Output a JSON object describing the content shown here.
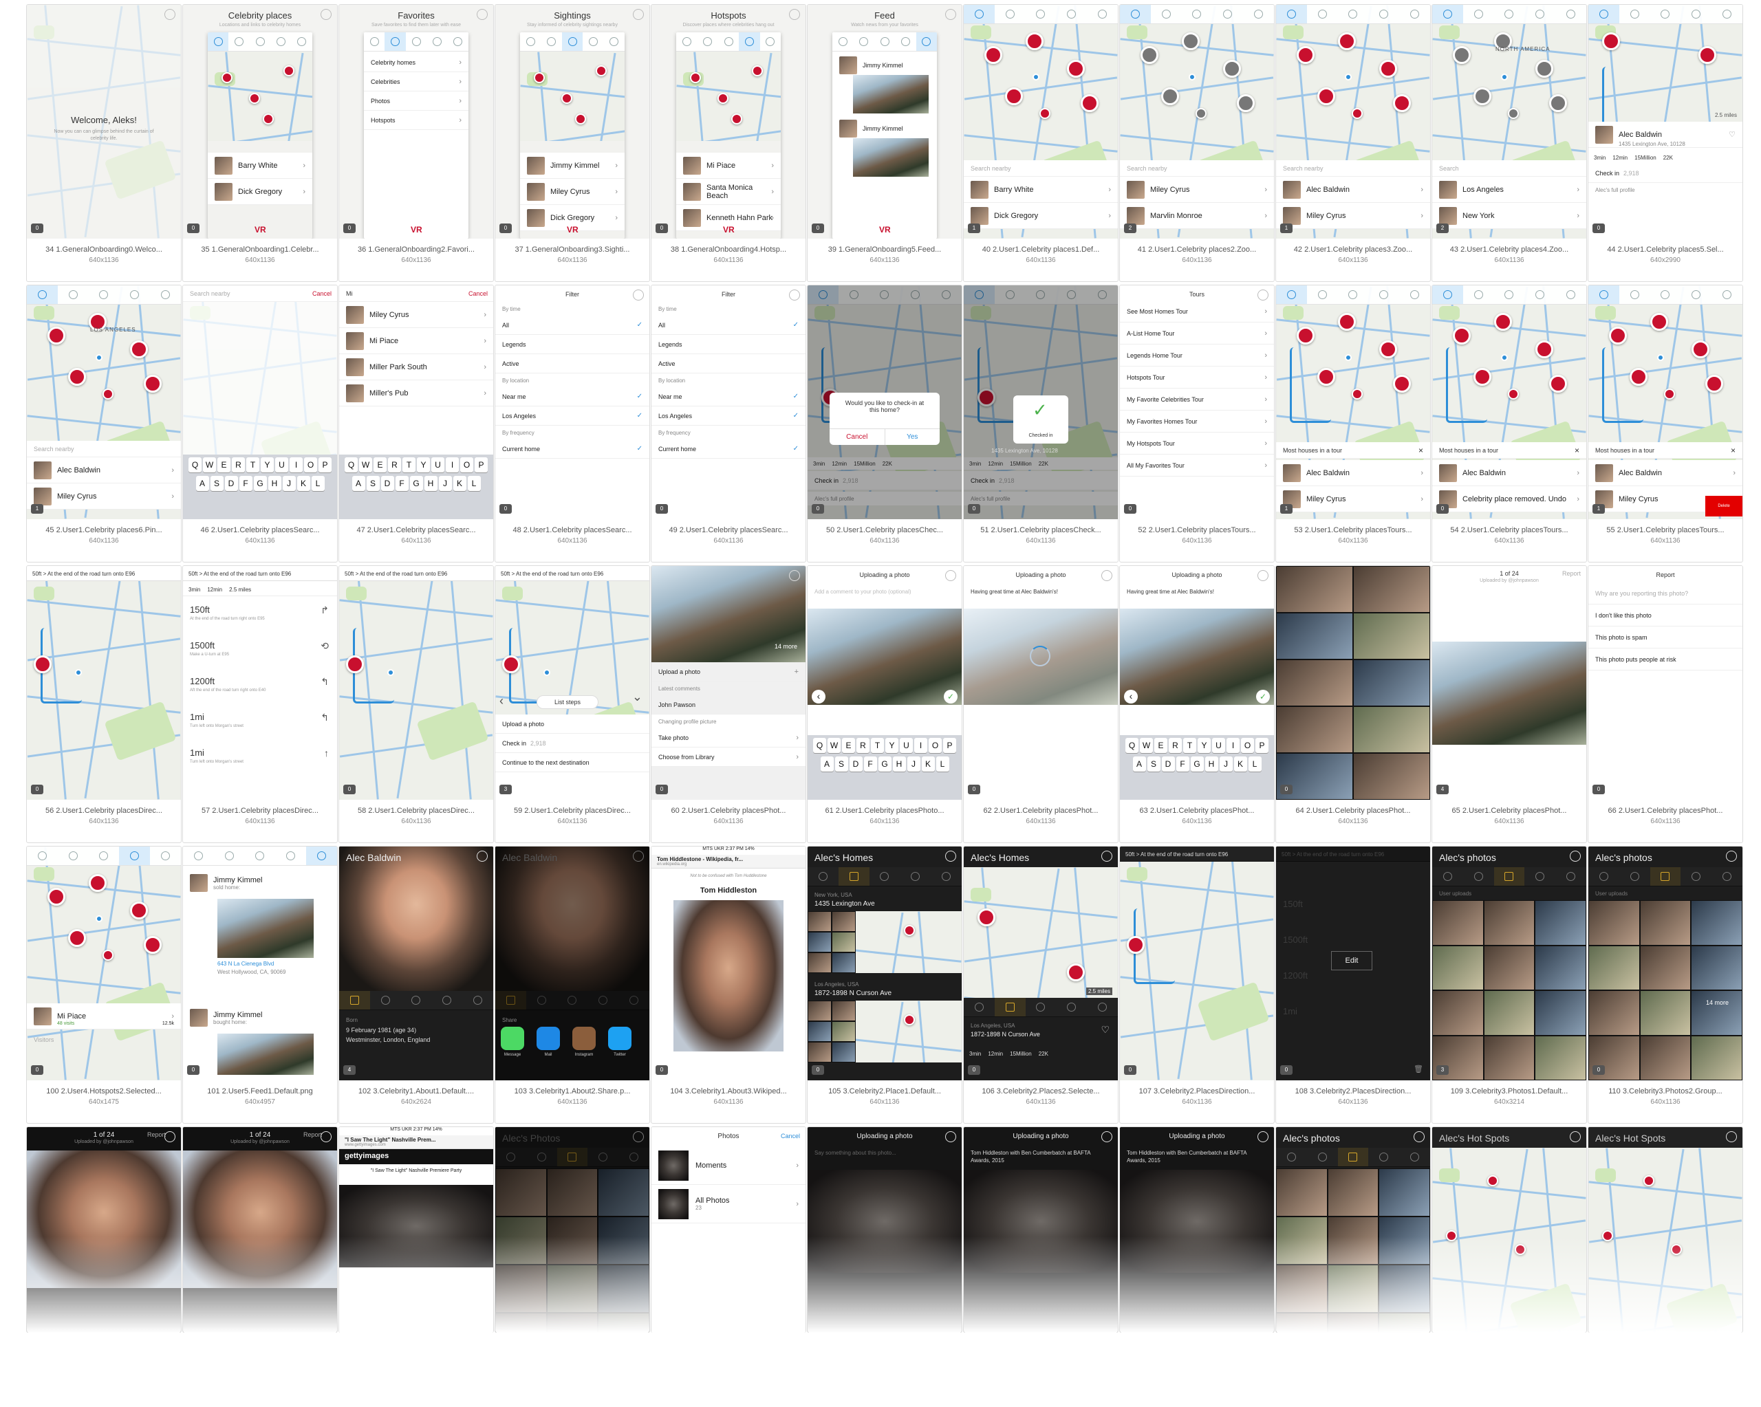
{
  "rows": [
    [
      {
        "caption": "34 1.GeneralOnboarding0.Welco...",
        "dims": "640x1136",
        "kind": "welcome",
        "title": "Welcome, Aleks!",
        "sub": "Now you can can glimpse behind the curtain of celebrity life.",
        "badge": "0"
      },
      {
        "caption": "35 1.GeneralOnboarding1.Celebr...",
        "dims": "640x1136",
        "kind": "onboard-map",
        "title": "Celebrity places",
        "sub": "Locations and links to celebrity homes",
        "list": [
          "Barry White",
          "Dick Gregory"
        ],
        "badge": "0"
      },
      {
        "caption": "36 1.GeneralOnboarding2.Favori...",
        "dims": "640x1136",
        "kind": "onboard-list",
        "title": "Favorites",
        "sub": "Save favorites to find them later with ease",
        "list": [
          "Celebrity homes",
          "Celebrities",
          "Photos",
          "Hotspots"
        ],
        "badge": "0"
      },
      {
        "caption": "37 1.GeneralOnboarding3.Sighti...",
        "dims": "640x1136",
        "kind": "onboard-map",
        "title": "Sightings",
        "sub": "Stay informed of celebrity sightings nearby",
        "list": [
          "Jimmy Kimmel",
          "Miley Cyrus",
          "Dick Gregory"
        ],
        "badge": "0"
      },
      {
        "caption": "38 1.GeneralOnboarding4.Hotsp...",
        "dims": "640x1136",
        "kind": "onboard-map",
        "title": "Hotspots",
        "sub": "Discover places where celebrities hang out",
        "list": [
          "Mi Piace",
          "Santa Monica Beach",
          "Kenneth Hahn Park"
        ],
        "badge": "0"
      },
      {
        "caption": "39 1.GeneralOnboarding5.Feed...",
        "dims": "640x1136",
        "kind": "onboard-feed",
        "title": "Feed",
        "sub": "Watch news from your favorites",
        "list": [
          "Jimmy Kimmel",
          "Jimmy Kimmel"
        ],
        "badge": "0"
      },
      {
        "caption": "40 2.User1.Celebrity places1.Def...",
        "dims": "640x1136",
        "kind": "map-list",
        "search": "Search nearby",
        "list": [
          "Barry White",
          "Dick Gregory"
        ],
        "badge": "1"
      },
      {
        "caption": "41 2.User1.Celebrity places2.Zoo...",
        "dims": "640x1136",
        "kind": "map-list",
        "search": "Search nearby",
        "list": [
          "Miley Cyrus",
          "Marvlin Monroe"
        ],
        "badge": "2"
      },
      {
        "caption": "42 2.User1.Celebrity places3.Zoo...",
        "dims": "640x1136",
        "kind": "map-list",
        "search": "Search nearby",
        "list": [
          "Alec Baldwin",
          "Miley Cyrus"
        ],
        "badge": "1"
      },
      {
        "caption": "43 2.User1.Celebrity places4.Zoo...",
        "dims": "640x1136",
        "kind": "map-list",
        "search": "Search",
        "list": [
          "Los Angeles",
          "New York"
        ],
        "badge": "2",
        "label": "NORTH AMERICA"
      },
      {
        "caption": "44 2.User1.Celebrity places5.Sel...",
        "dims": "640x2990",
        "kind": "map-detail",
        "list": [
          "Alec Baldwin"
        ],
        "detail": "1435 Lexington Ave, 10128",
        "stats": [
          "3min",
          "12min",
          "15Million",
          "22K"
        ],
        "checkin": "Check in",
        "checkin_count": "2,918",
        "extra": "Alec's full profile",
        "badge": "0"
      }
    ],
    [
      {
        "caption": "45 2.User1.Celebrity places6.Pin...",
        "dims": "640x1136",
        "kind": "map-list",
        "search": "Search nearby",
        "list": [
          "Alec Baldwin",
          "Miley Cyrus"
        ],
        "badge": "1",
        "label": "LOS ANGELES",
        "scale": "2.5 miles"
      },
      {
        "caption": "46 2.User1.Celebrity placesSearc...",
        "dims": "640x1136",
        "kind": "search-kbd",
        "search": "Search nearby",
        "cancel": "Cancel",
        "list": []
      },
      {
        "caption": "47 2.User1.Celebrity placesSearc...",
        "dims": "640x1136",
        "kind": "search-kbd",
        "search": "Mi",
        "cancel": "Cancel",
        "list": [
          "Miley Cyrus",
          "Mi Piace",
          "Miller Park South",
          "Miller's Pub"
        ]
      },
      {
        "caption": "48 2.User1.Celebrity placesSearc...",
        "dims": "640x1136",
        "kind": "filter",
        "title": "Filter",
        "list": [
          "By time",
          "All",
          "Legends",
          "Active",
          "By location",
          "Near me",
          "Los Angeles",
          "By frequency",
          "Current home"
        ],
        "badge": "0"
      },
      {
        "caption": "49 2.User1.Celebrity placesSearc...",
        "dims": "640x1136",
        "kind": "filter",
        "title": "Filter",
        "list": [
          "By time",
          "All",
          "Legends",
          "Active",
          "By location",
          "Near me",
          "Los Angeles",
          "By frequency",
          "Current home"
        ],
        "badge": "0"
      },
      {
        "caption": "50 2.User1.Celebrity placesChec...",
        "dims": "640x1136",
        "kind": "modal",
        "modal_text": "Would you like to check-in at this home?",
        "btn_no": "Cancel",
        "btn_yes": "Yes",
        "stats": [
          "3min",
          "12min",
          "15Million",
          "22K"
        ],
        "checkin": "Check in",
        "checkin_count": "2,918",
        "extra": "Alec's full profile",
        "badge": "0"
      },
      {
        "caption": "51 2.User1.Celebrity placesCheck...",
        "dims": "640x1136",
        "kind": "checked",
        "modal_text": "Checked in",
        "detail": "1435 Lexington Ave, 10128",
        "stats": [
          "3min",
          "12min",
          "15Million",
          "22K"
        ],
        "checkin": "Check in",
        "checkin_count": "2,918",
        "extra": "Alec's full profile",
        "badge": "0"
      },
      {
        "caption": "52 2.User1.Celebrity placesTours...",
        "dims": "640x1136",
        "kind": "tours",
        "title": "Tours",
        "list": [
          "See Most Homes Tour",
          "A-List Home Tour",
          "Legends Home Tour",
          "Hotspots Tour",
          "My Favorite Celebrities Tour",
          "My Favorites Homes Tour",
          "My Hotspots Tour",
          "All My Favorites Tour"
        ],
        "badge": "0"
      },
      {
        "caption": "53 2.User1.Celebrity placesTours...",
        "dims": "640x1136",
        "kind": "tour-map",
        "bar": "Most houses in a tour",
        "list": [
          "Alec Baldwin",
          "Miley Cyrus"
        ],
        "badge": "1"
      },
      {
        "caption": "54 2.User1.Celebrity placesTours...",
        "dims": "640x1136",
        "kind": "tour-map",
        "bar": "Most houses in a tour",
        "list": [
          "Alec Baldwin",
          "Celebrity place removed. Undo"
        ],
        "badge": "0"
      },
      {
        "caption": "55 2.User1.Celebrity placesTours...",
        "dims": "640x1136",
        "kind": "tour-map",
        "bar": "Most houses in a tour",
        "list": [
          "Alec Baldwin",
          "Miley Cyrus"
        ],
        "badge": "1",
        "delete": "Delete"
      }
    ],
    [
      {
        "caption": "56 2.User1.Celebrity placesDirec...",
        "dims": "640x1136",
        "kind": "dir-map",
        "nav": "50ft > At the end of the road turn onto E96",
        "badge": "0"
      },
      {
        "caption": "57 2.User1.Celebrity placesDirec...",
        "dims": "640x1136",
        "kind": "steps",
        "nav": "50ft > At the end of the road turn onto E96",
        "stats": [
          "3min",
          "12min",
          "2.5 miles"
        ],
        "steps": [
          {
            "d": "150ft",
            "t": "At the end of the road turn right onto E95"
          },
          {
            "d": "1500ft",
            "t": "Make a U-turn at E95"
          },
          {
            "d": "1200ft",
            "t": "Aft the end of the road turn right onto E40"
          },
          {
            "d": "1mi",
            "t": "Turn left onto Morgan's street"
          },
          {
            "d": "1mi",
            "t": "Turn left onto Morgan's street"
          }
        ]
      },
      {
        "caption": "58 2.User1.Celebrity placesDirec...",
        "dims": "640x1136",
        "kind": "dir-map",
        "nav": "50ft > At the end of the road turn onto E96",
        "badge": "0"
      },
      {
        "caption": "59 2.User1.Celebrity placesDirec...",
        "dims": "640x1136",
        "kind": "dir-steps",
        "nav": "50ft > At the end of the road turn onto E96",
        "pill": "List steps",
        "list": [
          "Upload a photo",
          "Check in",
          "Continue to the next destination"
        ],
        "checkin_count": "2,918",
        "badge": "3"
      },
      {
        "caption": "60 2.User1.Celebrity placesPhot...",
        "dims": "640x1136",
        "kind": "photo-actions",
        "more": "14 more",
        "list": [
          "Upload a photo",
          "Latest comments",
          "John Pawson",
          "Changing profile picture",
          "Take photo",
          "Choose from Library"
        ],
        "badge": "0"
      },
      {
        "caption": "61 2.User1.Celebrity placesPhoto...",
        "dims": "640x1136",
        "kind": "upload-kbd",
        "title": "Uploading a photo",
        "comment": "Add a comment to your photo (optional)"
      },
      {
        "caption": "62 2.User1.Celebrity placesPhot...",
        "dims": "640x1136",
        "kind": "upload-spin",
        "title": "Uploading a photo",
        "comment": "Having great time at Alec Baldwin's!",
        "badge": "0"
      },
      {
        "caption": "63 2.User1.Celebrity placesPhot...",
        "dims": "640x1136",
        "kind": "upload-kbd",
        "title": "Uploading a photo",
        "comment": "Having great time at Alec Baldwin's!"
      },
      {
        "caption": "64 2.User1.Celebrity placesPhot...",
        "dims": "640x1136",
        "kind": "mosaic",
        "badge": "0"
      },
      {
        "caption": "65 2.User1.Celebrity placesPhot...",
        "dims": "640x1136",
        "kind": "viewer",
        "title": "1 of 24",
        "sub": "Uploaded by @johnpawson",
        "report": "Report",
        "badge": "4"
      },
      {
        "caption": "66 2.User1.Celebrity placesPhot...",
        "dims": "640x1136",
        "kind": "report",
        "title": "Report",
        "list": [
          "Why are you reporting this photo?",
          "I don't like this photo",
          "This photo is spam",
          "This photo puts people at risk"
        ],
        "badge": "0"
      }
    ],
    [
      {
        "caption": "100 2.User4.Hotspots2.Selected...",
        "dims": "640x1475",
        "kind": "hotspot",
        "list": [
          "Mi Piace",
          "Visitors"
        ],
        "detail": "1872-1898 N Curson Ave",
        "visits": "48 visits",
        "count": "12.5k",
        "badge": "0",
        "scale": "2.5 miles"
      },
      {
        "caption": "101 2.User5.Feed1.Default.png",
        "dims": "640x4957",
        "kind": "feed",
        "list": [
          "Jimmy Kimmel",
          "Jimmy Kimmel"
        ],
        "sold": "sold home:",
        "bought": "bought home:",
        "addr": "643 N La Cienega Blvd",
        "city": "West Hollywood, CA, 90069",
        "badge": "0"
      },
      {
        "caption": "102 3.Celebrity1.About1.Default....",
        "dims": "640x2624",
        "kind": "about",
        "name": "Alec Baldwin",
        "born_label": "Born",
        "born": "9 February 1981 (age 34)",
        "place": "Westminster, London, England",
        "badge": "4"
      },
      {
        "caption": "103 3.Celebrity1.About2.Share.p...",
        "dims": "640x1136",
        "kind": "share",
        "name": "Alec Baldwin",
        "share": "Share",
        "apps": [
          "Message",
          "Mail",
          "Instagram",
          "Twitter"
        ]
      },
      {
        "caption": "104 3.Celebrity1.About3.Wikiped...",
        "dims": "640x1136",
        "kind": "wiki",
        "status": "MTS UKR   2:37 PM   14%",
        "page": "Tom Hiddlestone - Wikipedia, fr...",
        "url": "en.wikipedia.org",
        "note": "Not to be confused with Tom Huddlestone",
        "name": "Tom Hiddleston",
        "badge": "0"
      },
      {
        "caption": "105 3.Celebrity2.Place1.Default...",
        "dims": "640x1136",
        "kind": "homes-list",
        "name": "Alec's Homes",
        "list": [
          {
            "city": "New York, USA",
            "addr": "1435 Lexington Ave"
          },
          {
            "city": "Los Angeles, USA",
            "addr": "1872-1898 N Curson Ave"
          }
        ],
        "badge": "0"
      },
      {
        "caption": "106 3.Celebrity2.Places2.Selecte...",
        "dims": "640x1136",
        "kind": "homes-map",
        "name": "Alec's Homes",
        "city": "Los Angeles, USA",
        "addr": "1872-1898 N Curson Ave",
        "stats": [
          "3min",
          "12min",
          "15Million",
          "22K"
        ],
        "scale": "2.5 miles",
        "badge": "0"
      },
      {
        "caption": "107 3.Celebrity2.PlacesDirection...",
        "dims": "640x1136",
        "kind": "dark-dir",
        "nav": "50ft > At the end of the road turn onto E96",
        "badge": "0"
      },
      {
        "caption": "108 3.Celebrity2.PlacesDirection...",
        "dims": "640x1136",
        "kind": "dark-edit",
        "nav": "50ft > At the end of the road turn onto E96",
        "edit": "Edit",
        "steps": [
          "150ft",
          "1500ft",
          "1200ft",
          "1mi"
        ],
        "badge": "0"
      },
      {
        "caption": "109 3.Celebrity3.Photos1.Default...",
        "dims": "640x3214",
        "kind": "dark-photos",
        "name": "Alec's photos",
        "section": "User uploads",
        "badge": "3"
      },
      {
        "caption": "110 3.Celebrity3.Photos2.Group...",
        "dims": "640x1136",
        "kind": "dark-photos",
        "name": "Alec's photos",
        "section": "User uploads",
        "more": "14 more",
        "badge": "0"
      }
    ],
    [
      {
        "kind": "viewer-dark",
        "title": "1 of 24",
        "sub": "Uploaded by @johnpawson",
        "report": "Report"
      },
      {
        "kind": "viewer-dark",
        "title": "1 of 24",
        "sub": "Uploaded by @johnpawson",
        "report": "Report"
      },
      {
        "kind": "getty",
        "status": "MTS UKR   2:37 PM   14%",
        "page": "\"I Saw The Light\" Nashville Prem...",
        "url": "www.gettyimages.com",
        "brand": "gettyimages",
        "caption_text": "\"I Saw The Light\" Nashville Premiere Party"
      },
      {
        "kind": "dark-photos-dim",
        "name": "Alec's Photos"
      },
      {
        "kind": "photos-picker",
        "title": "Photos",
        "cancel": "Cancel",
        "list": [
          {
            "t": "Moments",
            "c": ""
          },
          {
            "t": "All Photos",
            "c": "23"
          }
        ]
      },
      {
        "kind": "upload-dark",
        "title": "Uploading a photo",
        "comment": "Say something about this photo..."
      },
      {
        "kind": "upload-dark",
        "title": "Uploading a photo",
        "comment": "Tom Hiddleston with Ben Cumberbatch at BAFTA Awards, 2015"
      },
      {
        "kind": "upload-dark",
        "title": "Uploading a photo",
        "comment": "Tom Hiddleston with Ben Cumberbatch at BAFTA Awards, 2015"
      },
      {
        "kind": "dark-photos",
        "name": "Alec's photos"
      },
      {
        "kind": "hot-spots",
        "name": "Alec's Hot Spots"
      },
      {
        "kind": "hot-spots",
        "name": "Alec's Hot Spots"
      }
    ]
  ]
}
